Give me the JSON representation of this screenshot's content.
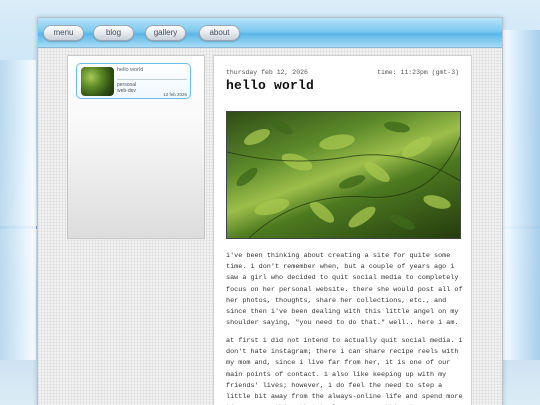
{
  "nav": {
    "items": [
      {
        "label": "menu"
      },
      {
        "label": "blog"
      },
      {
        "label": "gallery"
      },
      {
        "label": "about"
      }
    ]
  },
  "sidebar": {
    "posts": [
      {
        "title": "hello world",
        "tags": [
          "personal",
          "web-dev"
        ],
        "date": "12 feb 2026"
      }
    ]
  },
  "entry": {
    "date": "thursday feb 12, 2026",
    "time": "time: 11:23pm (gmt-3)",
    "title": "hello world",
    "paragraphs": [
      "i've been thinking about creating a site for quite some time. i don't remember when, but a couple of years ago i saw a girl who decided to quit social media to completely focus on her personal website. there she would post all of her photos, thoughts, share her collections, etc., and since then i've been dealing with this little angel on my shoulder saying, \"you need to do that.\" well.. here i am.",
      "at first i did not intend to actually quit social media. i don't hate instagram; there i can share recipe reels with my mom and, since i live far from her, it is one of our main points of contact. i also like keeping up with my friends' lives; however, i do feel the need to step a little bit away from the always-online life and spend more time on something that truly means something to me."
    ]
  },
  "colors": {
    "nav_bar": "#7ccaf0",
    "card_border": "#6cbde9",
    "page_bg": "#c4e2f6"
  }
}
